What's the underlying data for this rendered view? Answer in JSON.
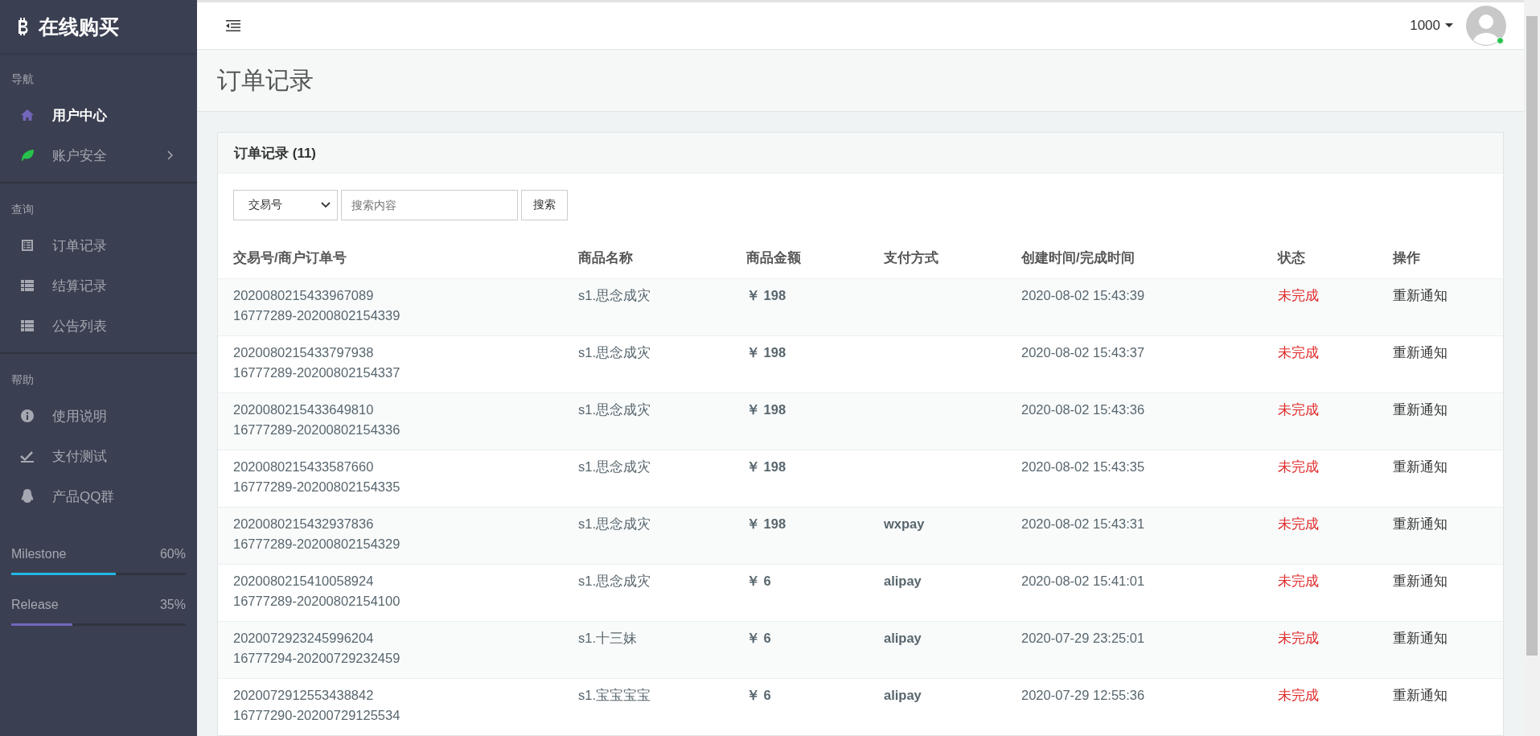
{
  "brand": {
    "title": "在线购买"
  },
  "sidebar": {
    "sections": [
      {
        "heading": "导航",
        "items": [
          {
            "label": "用户中心",
            "selected": true
          },
          {
            "label": "账户安全",
            "selected": false,
            "expanded": false
          }
        ]
      },
      {
        "heading": "查询",
        "items": [
          {
            "label": "订单记录",
            "selected": false
          },
          {
            "label": "结算记录",
            "selected": false
          },
          {
            "label": "公告列表",
            "selected": false
          }
        ]
      },
      {
        "heading": "帮助",
        "items": [
          {
            "label": "使用说明",
            "selected": false
          },
          {
            "label": "支付测试",
            "selected": false
          },
          {
            "label": "产品QQ群",
            "selected": false
          }
        ]
      }
    ],
    "progress": [
      {
        "label": "Milestone",
        "reading": "60%",
        "level": 0.6,
        "color": "#23b7e5"
      },
      {
        "label": "Release",
        "reading": "35%",
        "level": 0.35,
        "color": "#7266ba"
      }
    ]
  },
  "header": {
    "user": "1000",
    "online": true
  },
  "page_title": "订单记录",
  "card": {
    "title": "订单记录 (11)",
    "search": {
      "field": "交易号",
      "placeholder": "搜索内容",
      "button": "搜索"
    },
    "table": {
      "columns": [
        "交易号/商户订单号",
        "商品名称",
        "商品金额",
        "支付方式",
        "创建时间/完成时间",
        "状态",
        "操作"
      ],
      "rows": [
        {
          "trade_no": "2020080215433967089",
          "order_no": "16777289-20200802154339",
          "product": "s1.思念成灾",
          "amount": "￥ 198",
          "time": "2020-08-02 15:43:39",
          "status": "未完成",
          "action": "重新通知"
        },
        {
          "trade_no": "2020080215433797938",
          "order_no": "16777289-20200802154337",
          "product": "s1.思念成灾",
          "amount": "￥ 198",
          "time": "2020-08-02 15:43:37",
          "status": "未完成",
          "action": "重新通知"
        },
        {
          "trade_no": "2020080215433649810",
          "order_no": "16777289-20200802154336",
          "product": "s1.思念成灾",
          "amount": "￥ 198",
          "time": "2020-08-02 15:43:36",
          "status": "未完成",
          "action": "重新通知"
        },
        {
          "trade_no": "2020080215433587660",
          "order_no": "16777289-20200802154335",
          "product": "s1.思念成灾",
          "amount": "￥ 198",
          "time": "2020-08-02 15:43:35",
          "status": "未完成",
          "action": "重新通知"
        },
        {
          "trade_no": "2020080215432937836",
          "order_no": "16777289-20200802154329",
          "product": "s1.思念成灾",
          "amount": "￥ 198",
          "pay": "wxpay",
          "time": "2020-08-02 15:43:31",
          "status": "未完成",
          "action": "重新通知"
        },
        {
          "trade_no": "2020080215410058924",
          "order_no": "16777289-20200802154100",
          "product": "s1.思念成灾",
          "amount": "￥ 6",
          "pay": "alipay",
          "time": "2020-08-02 15:41:01",
          "status": "未完成",
          "action": "重新通知"
        },
        {
          "trade_no": "2020072923245996204",
          "order_no": "16777294-20200729232459",
          "product": "s1.十三妹",
          "amount": "￥ 6",
          "pay": "alipay",
          "time": "2020-07-29 23:25:01",
          "status": "未完成",
          "action": "重新通知"
        },
        {
          "trade_no": "2020072912553438842",
          "order_no": "16777290-20200729125534",
          "product": "s1.宝宝宝宝",
          "amount": "￥ 6",
          "pay": "alipay",
          "time": "2020-07-29 12:55:36",
          "status": "未完成",
          "action": "重新通知"
        }
      ]
    }
  }
}
